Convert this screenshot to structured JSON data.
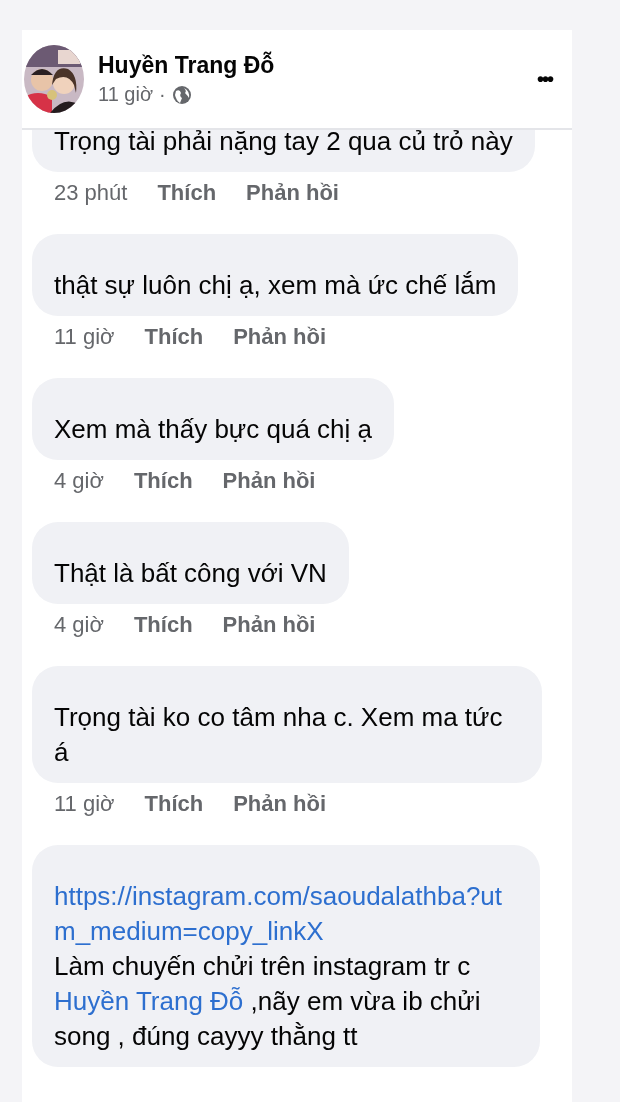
{
  "post": {
    "author": "Huyền Trang Đỗ",
    "time": "11 giờ",
    "separator": "·",
    "menu": "•••"
  },
  "comments": [
    {
      "text": "Trọng tài phải nặng tay 2 qua củ trỏ này",
      "time": "23 phút",
      "like": "Thích",
      "reply": "Phản hồi"
    },
    {
      "text": "thật sự luôn chị ạ, xem mà ức  chế lắm",
      "time": "11 giờ",
      "like": "Thích",
      "reply": "Phản hồi"
    },
    {
      "text": "Xem mà thấy bực quá chị ạ",
      "time": "4 giờ",
      "like": "Thích",
      "reply": "Phản hồi"
    },
    {
      "text": "Thật là bất công với VN",
      "time": "4 giờ",
      "like": "Thích",
      "reply": "Phản hồi"
    },
    {
      "text": "Trọng tài ko co tâm nha c. Xem ma tức á",
      "time": "11 giờ",
      "like": "Thích",
      "reply": "Phản hồi"
    },
    {
      "parts": [
        {
          "kind": "link",
          "text": "https://instagram.com/saoudalathba?utm_medium=copy_linkX"
        },
        {
          "kind": "text",
          "text": "Làm chuyến chửi trên instagram tr c "
        },
        {
          "kind": "mention",
          "text": "Huyền Trang Đỗ"
        },
        {
          "kind": "text",
          "text": " ,nãy em vừa ib chửi song , đúng cayyy thằng tt"
        }
      ]
    }
  ]
}
